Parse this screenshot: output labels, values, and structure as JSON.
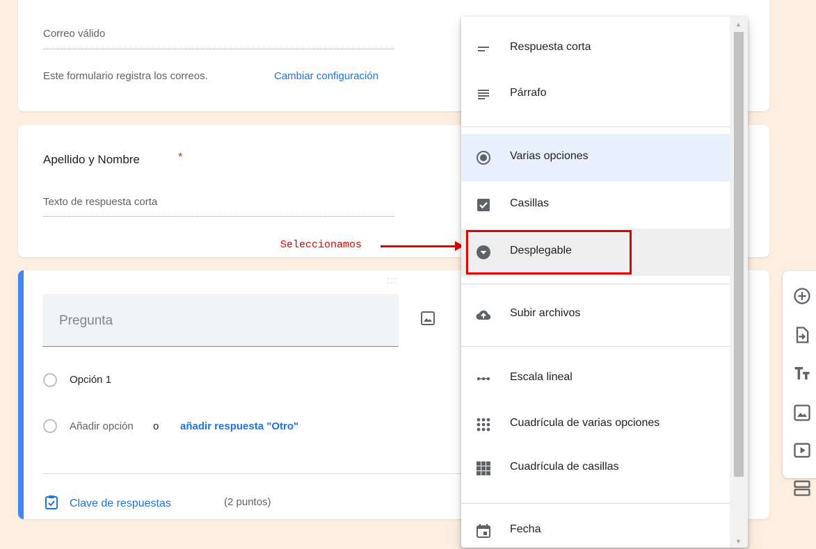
{
  "email_card": {
    "field_label": "Correo válido",
    "notice_text": "Este formulario registra los correos.",
    "change_settings_link": "Cambiar configuración"
  },
  "name_card": {
    "question_title": "Apellido y Nombre",
    "required_mark": "*",
    "answer_placeholder": "Texto de respuesta corta"
  },
  "question_card": {
    "question_placeholder": "Pregunta",
    "option_1": "Opción 1",
    "add_option": "Añadir opción",
    "or_text": "o",
    "add_other_link": "añadir respuesta \"Otro\"",
    "answer_key_label": "Clave de respuestas",
    "points_text": "(2 puntos)"
  },
  "annotation": {
    "text": "Seleccionamos"
  },
  "type_menu": {
    "items": [
      {
        "label": "Respuesta corta",
        "icon": "short-text-icon"
      },
      {
        "label": "Párrafo",
        "icon": "paragraph-icon"
      },
      {
        "label": "Varias opciones",
        "icon": "radio-button-icon",
        "selected": true
      },
      {
        "label": "Casillas",
        "icon": "checkbox-icon"
      },
      {
        "label": "Desplegable",
        "icon": "dropdown-icon",
        "highlighted": true
      },
      {
        "label": "Subir archivos",
        "icon": "cloud-upload-icon"
      },
      {
        "label": "Escala lineal",
        "icon": "linear-scale-icon"
      },
      {
        "label": "Cuadrícula de varias opciones",
        "icon": "dot-grid-icon"
      },
      {
        "label": "Cuadrícula de casillas",
        "icon": "checkbox-grid-icon"
      },
      {
        "label": "Fecha",
        "icon": "calendar-icon"
      }
    ]
  },
  "colors": {
    "accent_blue": "#1a73e8",
    "card_accent": "#4285f4",
    "selected_item_bg": "#e8f0fe",
    "annotation_red": "#e00000",
    "page_bg": "#fdeee1"
  }
}
